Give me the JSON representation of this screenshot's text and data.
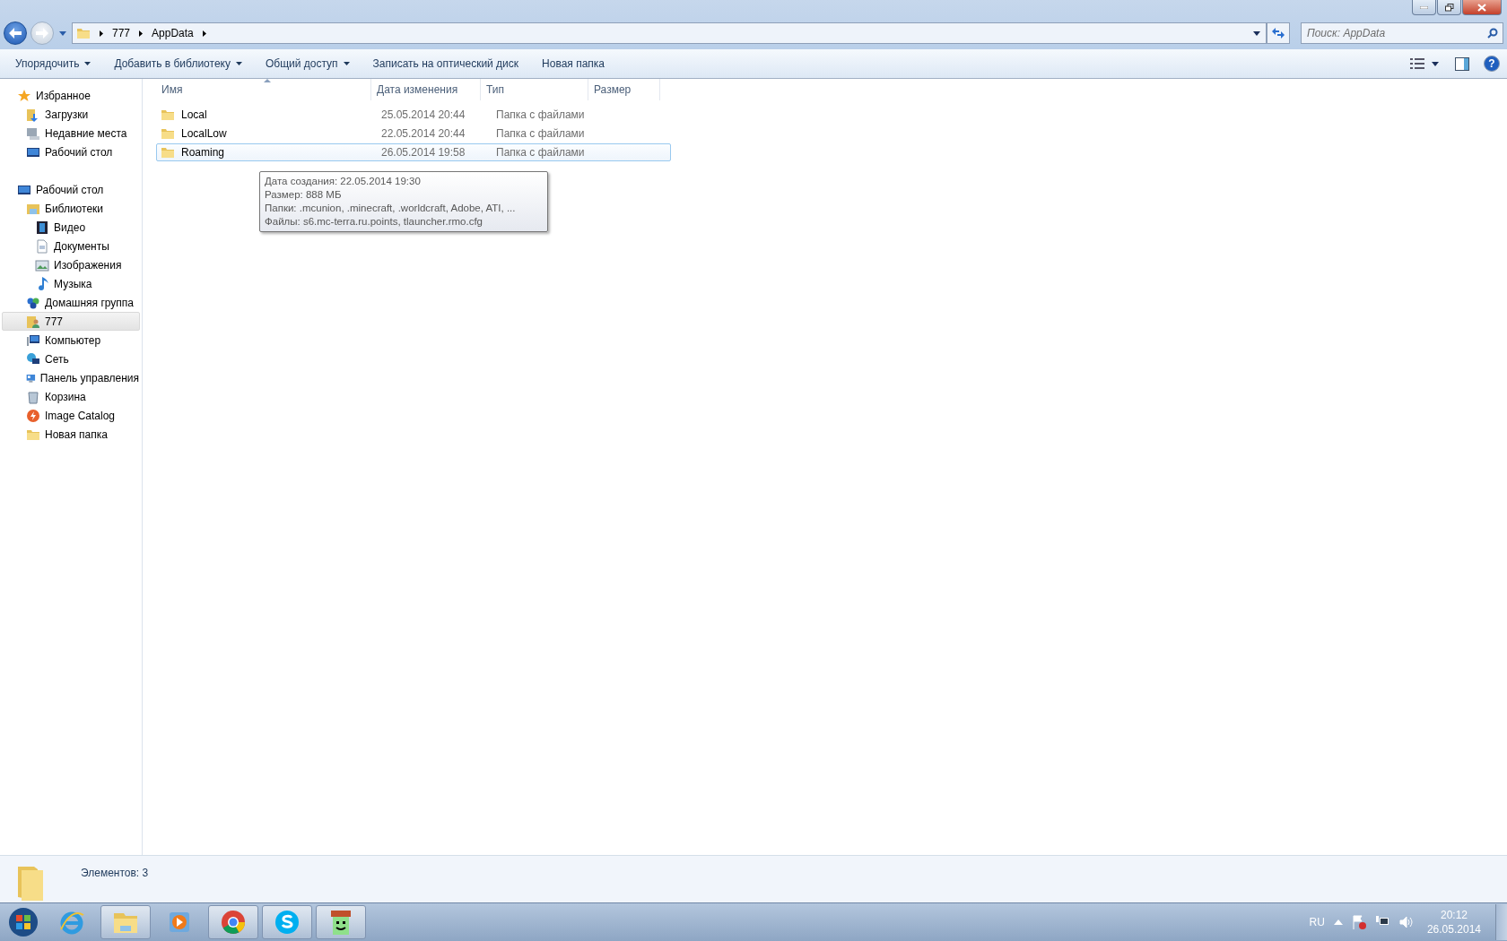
{
  "breadcrumb": {
    "parts": [
      "777",
      "AppData"
    ]
  },
  "search": {
    "placeholder": "Поиск: AppData"
  },
  "help_button": {
    "label": "?"
  },
  "toolbar": {
    "items": [
      {
        "label": "Упорядочить",
        "dropdown": true
      },
      {
        "label": "Добавить в библиотеку",
        "dropdown": true
      },
      {
        "label": "Общий доступ",
        "dropdown": true
      },
      {
        "label": "Записать на оптический диск",
        "dropdown": false
      },
      {
        "label": "Новая папка",
        "dropdown": false
      }
    ]
  },
  "sidebar": {
    "items": [
      {
        "label": "Избранное",
        "kind": "star",
        "selected": false,
        "children": [
          {
            "label": "Загрузки",
            "kind": "download",
            "selected": false
          },
          {
            "label": "Недавние места",
            "kind": "recent",
            "selected": false
          },
          {
            "label": "Рабочий стол",
            "kind": "desktop",
            "selected": false
          }
        ]
      },
      {
        "label": "Рабочий стол",
        "kind": "desktop",
        "selected": false,
        "children": [
          {
            "label": "Библиотеки",
            "kind": "library",
            "selected": false,
            "children": [
              {
                "label": "Видео",
                "kind": "video",
                "selected": false
              },
              {
                "label": "Документы",
                "kind": "document",
                "selected": false
              },
              {
                "label": "Изображения",
                "kind": "picture",
                "selected": false
              },
              {
                "label": "Музыка",
                "kind": "music",
                "selected": false
              }
            ]
          },
          {
            "label": "Домашняя группа",
            "kind": "homegroup",
            "selected": false
          },
          {
            "label": "777",
            "kind": "user",
            "selected": true
          },
          {
            "label": "Компьютер",
            "kind": "computer",
            "selected": false
          },
          {
            "label": "Сеть",
            "kind": "network",
            "selected": false
          },
          {
            "label": "Панель управления",
            "kind": "control",
            "selected": false
          },
          {
            "label": "Корзина",
            "kind": "bin",
            "selected": false
          },
          {
            "label": "Image Catalog",
            "kind": "app",
            "selected": false
          },
          {
            "label": "Новая папка",
            "kind": "folder",
            "selected": false
          }
        ]
      }
    ]
  },
  "table": {
    "columns": [
      "Имя",
      "Дата изменения",
      "Тип",
      "Размер"
    ],
    "rows": [
      {
        "name": "Local",
        "modified": "25.05.2014 20:44",
        "type": "Папка с файлами",
        "selected": false
      },
      {
        "name": "LocalLow",
        "modified": "22.05.2014 20:44",
        "type": "Папка с файлами",
        "selected": false
      },
      {
        "name": "Roaming",
        "modified": "26.05.2014 19:58",
        "type": "Папка с файлами",
        "selected": true
      }
    ]
  },
  "tooltip": {
    "lines": [
      "Дата создания: 22.05.2014 19:30",
      "Размер: 888 МБ",
      "Папки: .mcunion, .minecraft, .worldcraft, Adobe, ATI, ...",
      "Файлы: s6.mc-terra.ru.points, tlauncher.rmo.cfg"
    ]
  },
  "status_bar": {
    "text": "Элементов: 3"
  },
  "taskbar": {
    "apps": [
      {
        "kind": "ie",
        "active": false
      },
      {
        "kind": "explorer",
        "active": true
      },
      {
        "kind": "media",
        "active": false
      },
      {
        "kind": "chrome",
        "active": true
      },
      {
        "kind": "skype",
        "active": true
      },
      {
        "kind": "game",
        "active": true
      }
    ],
    "language": "RU",
    "time": "20:12",
    "date": "26.05.2014"
  }
}
